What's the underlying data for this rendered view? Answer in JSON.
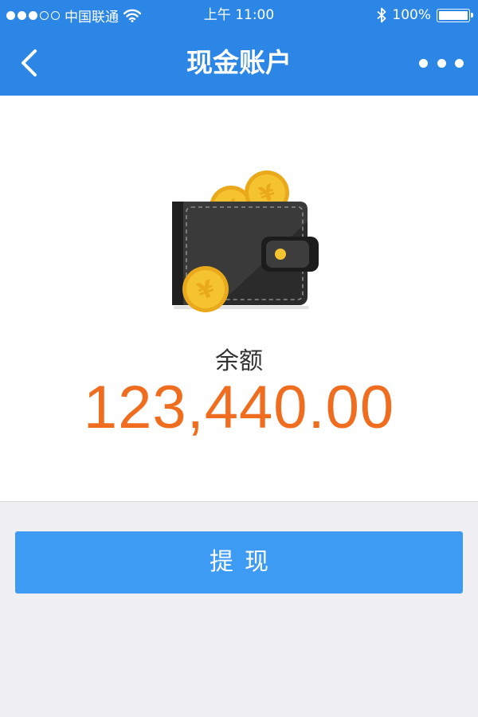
{
  "status_bar": {
    "carrier": "中国联通",
    "time": "上午 11:00",
    "battery": "100%",
    "signal_filled_dots": 3,
    "signal_total_dots": 5
  },
  "nav": {
    "title": "现金账户",
    "back_icon": "chevron-left-icon",
    "more_icon": "more-dots-icon"
  },
  "account": {
    "balance_label": "余额",
    "balance_value": "123,440.00",
    "illustration_icon": "wallet-icon"
  },
  "actions": {
    "withdraw_label": "提现"
  },
  "colors": {
    "primary": "#2c86e6",
    "button": "#3d9bf3",
    "amount": "#f06d1f",
    "coin": "#f5c330",
    "wallet": "#2f2f2f",
    "background": "#efeff4"
  }
}
